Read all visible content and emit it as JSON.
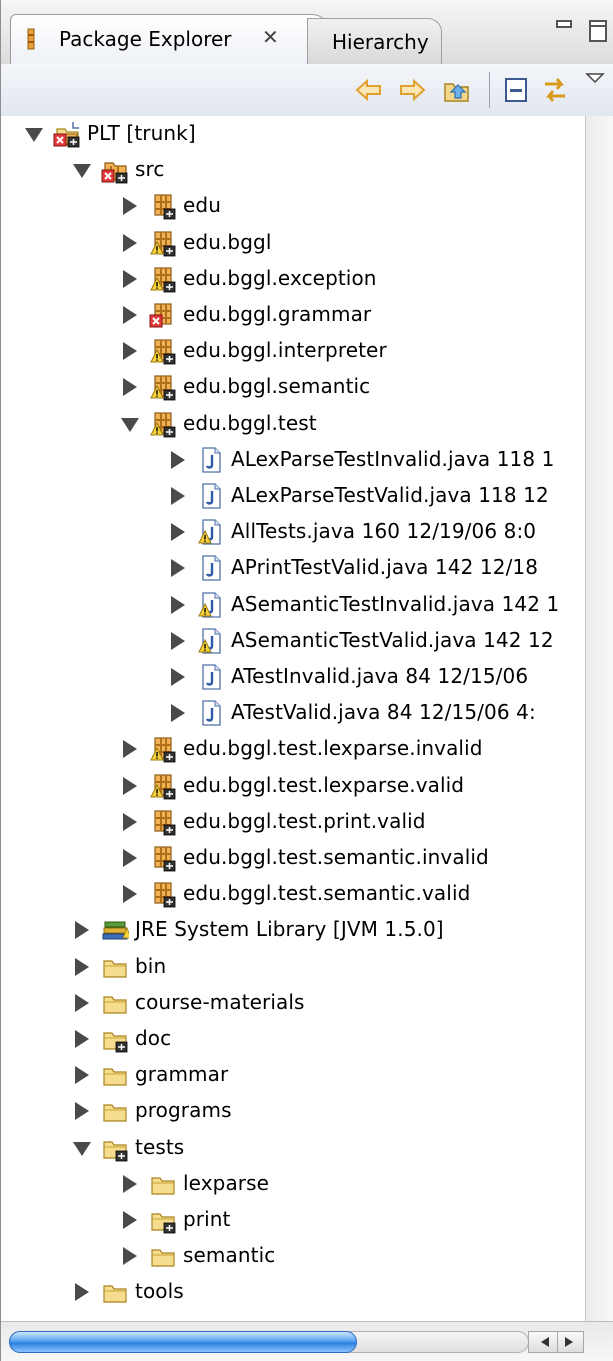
{
  "tabs": {
    "active_label": "Package Explorer",
    "close_symbol": "✕",
    "inactive_label": "Hierarchy"
  },
  "toolbar": {
    "buttons": [
      "back-arrow-icon",
      "forward-arrow-icon",
      "up-folder-icon",
      "collapse-all-icon",
      "link-with-editor-icon",
      "view-menu-icon"
    ]
  },
  "tree": [
    {
      "label": "PLT [trunk]",
      "depth": 0,
      "expanded": true,
      "icon": "project-icon"
    },
    {
      "label": "src",
      "depth": 1,
      "expanded": true,
      "icon": "source-folder-error-icon"
    },
    {
      "label": "edu",
      "depth": 2,
      "expanded": false,
      "icon": "package-icon"
    },
    {
      "label": "edu.bggl",
      "depth": 2,
      "expanded": false,
      "icon": "package-warning-icon"
    },
    {
      "label": "edu.bggl.exception",
      "depth": 2,
      "expanded": false,
      "icon": "package-warning-icon"
    },
    {
      "label": "edu.bggl.grammar",
      "depth": 2,
      "expanded": false,
      "icon": "package-error-icon"
    },
    {
      "label": "edu.bggl.interpreter",
      "depth": 2,
      "expanded": false,
      "icon": "package-warning-icon"
    },
    {
      "label": "edu.bggl.semantic",
      "depth": 2,
      "expanded": false,
      "icon": "package-warning-icon"
    },
    {
      "label": "edu.bggl.test",
      "depth": 2,
      "expanded": true,
      "icon": "package-warning-icon"
    },
    {
      "label": "ALexParseTestInvalid.java 118  1",
      "depth": 3,
      "expanded": false,
      "icon": "java-file-icon"
    },
    {
      "label": "ALexParseTestValid.java 118  12",
      "depth": 3,
      "expanded": false,
      "icon": "java-file-icon"
    },
    {
      "label": "AllTests.java 160  12/19/06 8:0",
      "depth": 3,
      "expanded": false,
      "icon": "java-file-warning-icon"
    },
    {
      "label": "APrintTestValid.java 142  12/18",
      "depth": 3,
      "expanded": false,
      "icon": "java-file-icon"
    },
    {
      "label": "ASemanticTestInvalid.java 142  1",
      "depth": 3,
      "expanded": false,
      "icon": "java-file-warning-icon"
    },
    {
      "label": "ASemanticTestValid.java 142  12",
      "depth": 3,
      "expanded": false,
      "icon": "java-file-warning-icon"
    },
    {
      "label": "ATestInvalid.java 84  12/15/06",
      "depth": 3,
      "expanded": false,
      "icon": "java-file-icon"
    },
    {
      "label": "ATestValid.java 84  12/15/06 4:",
      "depth": 3,
      "expanded": false,
      "icon": "java-file-icon"
    },
    {
      "label": "edu.bggl.test.lexparse.invalid",
      "depth": 2,
      "expanded": false,
      "icon": "package-warning-icon"
    },
    {
      "label": "edu.bggl.test.lexparse.valid",
      "depth": 2,
      "expanded": false,
      "icon": "package-warning-icon"
    },
    {
      "label": "edu.bggl.test.print.valid",
      "depth": 2,
      "expanded": false,
      "icon": "package-icon"
    },
    {
      "label": "edu.bggl.test.semantic.invalid",
      "depth": 2,
      "expanded": false,
      "icon": "package-icon"
    },
    {
      "label": "edu.bggl.test.semantic.valid",
      "depth": 2,
      "expanded": false,
      "icon": "package-icon"
    },
    {
      "label": "JRE System Library [JVM 1.5.0]",
      "depth": 1,
      "expanded": false,
      "icon": "library-icon"
    },
    {
      "label": "bin",
      "depth": 1,
      "expanded": false,
      "icon": "folder-icon"
    },
    {
      "label": "course-materials",
      "depth": 1,
      "expanded": false,
      "icon": "folder-icon"
    },
    {
      "label": "doc",
      "depth": 1,
      "expanded": false,
      "icon": "folder-decorated-icon"
    },
    {
      "label": "grammar",
      "depth": 1,
      "expanded": false,
      "icon": "folder-icon"
    },
    {
      "label": "programs",
      "depth": 1,
      "expanded": false,
      "icon": "folder-icon"
    },
    {
      "label": "tests",
      "depth": 1,
      "expanded": true,
      "icon": "folder-decorated-icon"
    },
    {
      "label": "lexparse",
      "depth": 2,
      "expanded": false,
      "icon": "folder-icon"
    },
    {
      "label": "print",
      "depth": 2,
      "expanded": false,
      "icon": "folder-decorated-icon"
    },
    {
      "label": "semantic",
      "depth": 2,
      "expanded": false,
      "icon": "folder-icon"
    },
    {
      "label": "tools",
      "depth": 1,
      "expanded": false,
      "icon": "folder-icon"
    }
  ],
  "scrollbar": {
    "horizontal_position": 0,
    "horizontal_thumb_fraction": 0.67
  }
}
